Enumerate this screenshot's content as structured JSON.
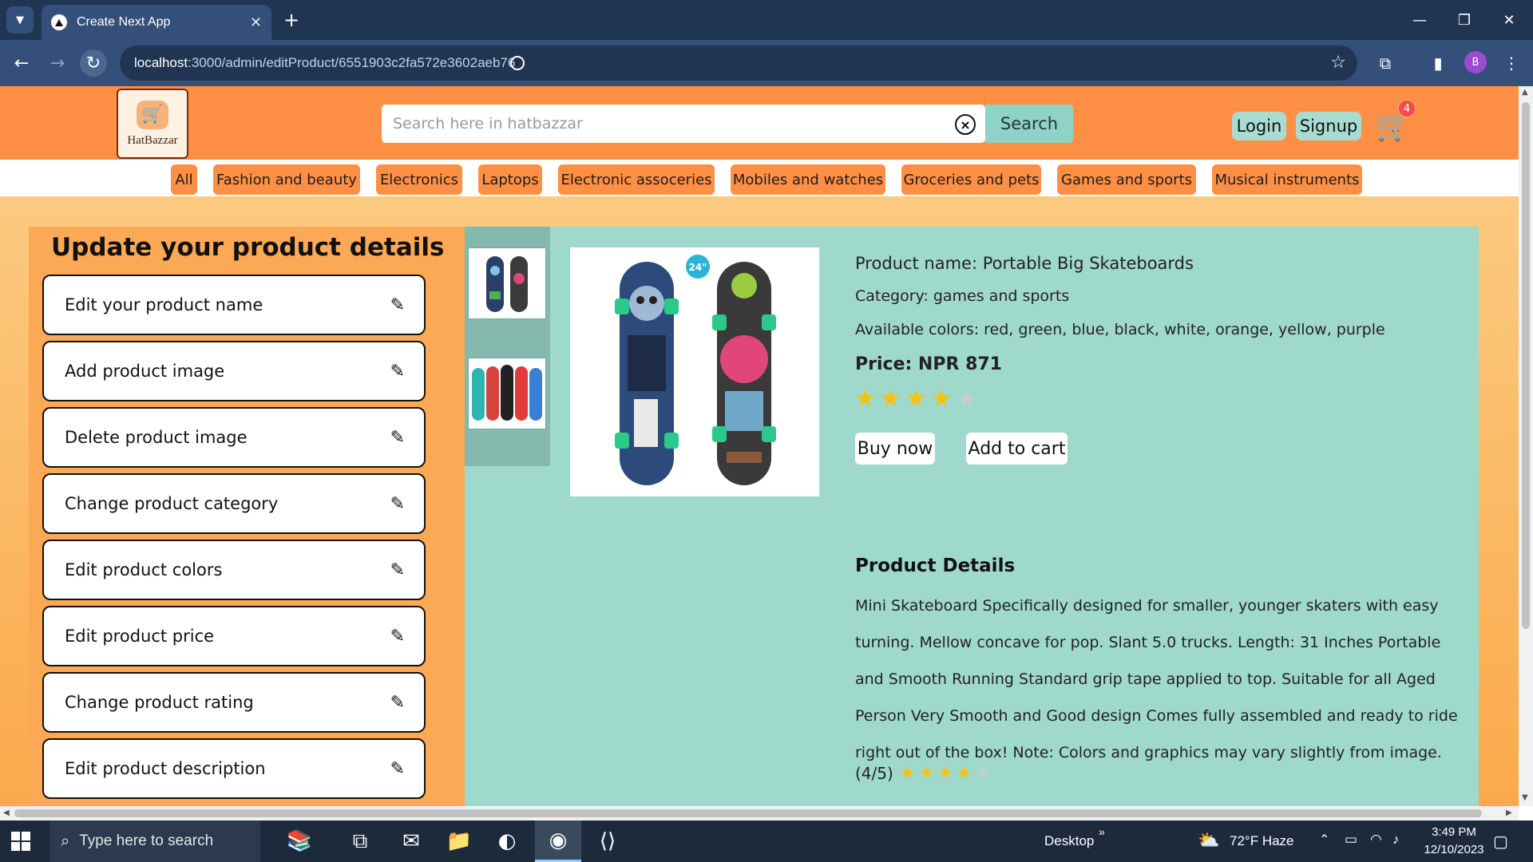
{
  "browser": {
    "tab_title": "Create Next App",
    "url_host": "localhost",
    "url_path": ":3000/admin/editProduct/6551903c2fa572e3602aeb76",
    "profile_initial": "B"
  },
  "header": {
    "logo_text": "HatBazzar",
    "search_placeholder": "Search here in hatbazzar",
    "search_button": "Search",
    "login": "Login",
    "signup": "Signup",
    "cart_count": "4"
  },
  "categories": [
    "All",
    "Fashion and beauty",
    "Electronics",
    "Laptops",
    "Electronic assoceries",
    "Mobiles and watches",
    "Groceries and pets",
    "Games and sports",
    "Musical instruments"
  ],
  "editor": {
    "title": "Update your product details",
    "items": [
      "Edit your product name",
      "Add product image",
      "Delete product image",
      "Change product category",
      "Edit product colors",
      "Edit product price",
      "Change product rating",
      "Edit product description"
    ]
  },
  "product": {
    "name_line": "Product name: Portable Big Skateboards",
    "category_line": "Category: games and sports",
    "colors_line": "Available colors: red, green, blue, black, white, orange, yellow, purple",
    "price_line": "Price: NPR 871",
    "rating": 4,
    "rating_max": 5,
    "buy_now": "Buy now",
    "add_to_cart": "Add to cart",
    "image_badge": "24\"",
    "details_title": "Product Details",
    "description": "Mini Skateboard Specifically designed for smaller, younger skaters with easy turning. Mellow concave for pop. Slant 5.0 trucks. Length: 31 Inches Portable and Smooth Running Standard grip tape applied to top. Suitable for all Aged Person Very Smooth and Good design Comes fully assembled and ready to ride right out of the box! Note: Colors and graphics may vary slightly from image.",
    "rating_text": "(4/5)"
  },
  "taskbar": {
    "search_placeholder": "Type here to search",
    "desktop_label": "Desktop",
    "weather": "72°F  Haze",
    "time": "3:49 PM",
    "date": "12/10/2023"
  },
  "colors": {
    "header_orange": "#ff8f45",
    "panel_teal": "#9fd9cb",
    "star_gold": "#f5c211",
    "browser_dark": "#1f3552"
  }
}
